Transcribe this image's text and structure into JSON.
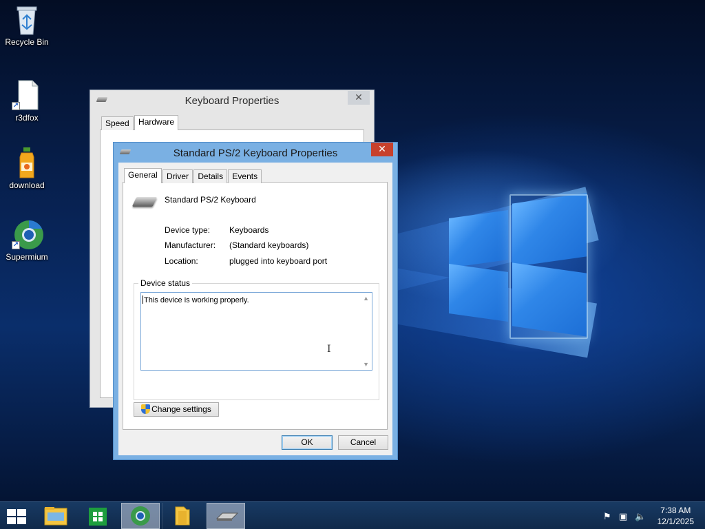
{
  "desktop": {
    "icons": [
      {
        "label": "Recycle Bin",
        "icon": "recycle-bin-icon"
      },
      {
        "label": "r3dfox",
        "icon": "file-shortcut-icon"
      },
      {
        "label": "download",
        "icon": "juice-bottle-icon"
      },
      {
        "label": "Supermium",
        "icon": "browser-icon"
      }
    ]
  },
  "back_window": {
    "title": "Keyboard Properties",
    "close_symbol": "✕",
    "tabs": [
      "Speed",
      "Hardware"
    ],
    "active_tab": "Hardware"
  },
  "dialog": {
    "title": "Standard PS/2 Keyboard Properties",
    "close_symbol": "✕",
    "tabs": [
      "General",
      "Driver",
      "Details",
      "Events"
    ],
    "active_tab": "General",
    "device_name": "Standard PS/2 Keyboard",
    "properties": [
      {
        "label": "Device type:",
        "value": "Keyboards"
      },
      {
        "label": "Manufacturer:",
        "value": "(Standard keyboards)"
      },
      {
        "label": "Location:",
        "value": "plugged into keyboard port"
      }
    ],
    "status_group_label": "Device status",
    "status_text": "This device is working properly.",
    "change_settings_label": "Change settings",
    "ok_label": "OK",
    "cancel_label": "Cancel"
  },
  "taskbar": {
    "apps": [
      "start-button",
      "file-explorer",
      "store",
      "supermium",
      "folder",
      "keyboard-properties"
    ],
    "active_app": "keyboard-properties",
    "time": "7:38 AM",
    "date": "12/1/2025",
    "tray_icons": [
      "flag-icon",
      "network-icon",
      "volume-muted-icon"
    ]
  }
}
